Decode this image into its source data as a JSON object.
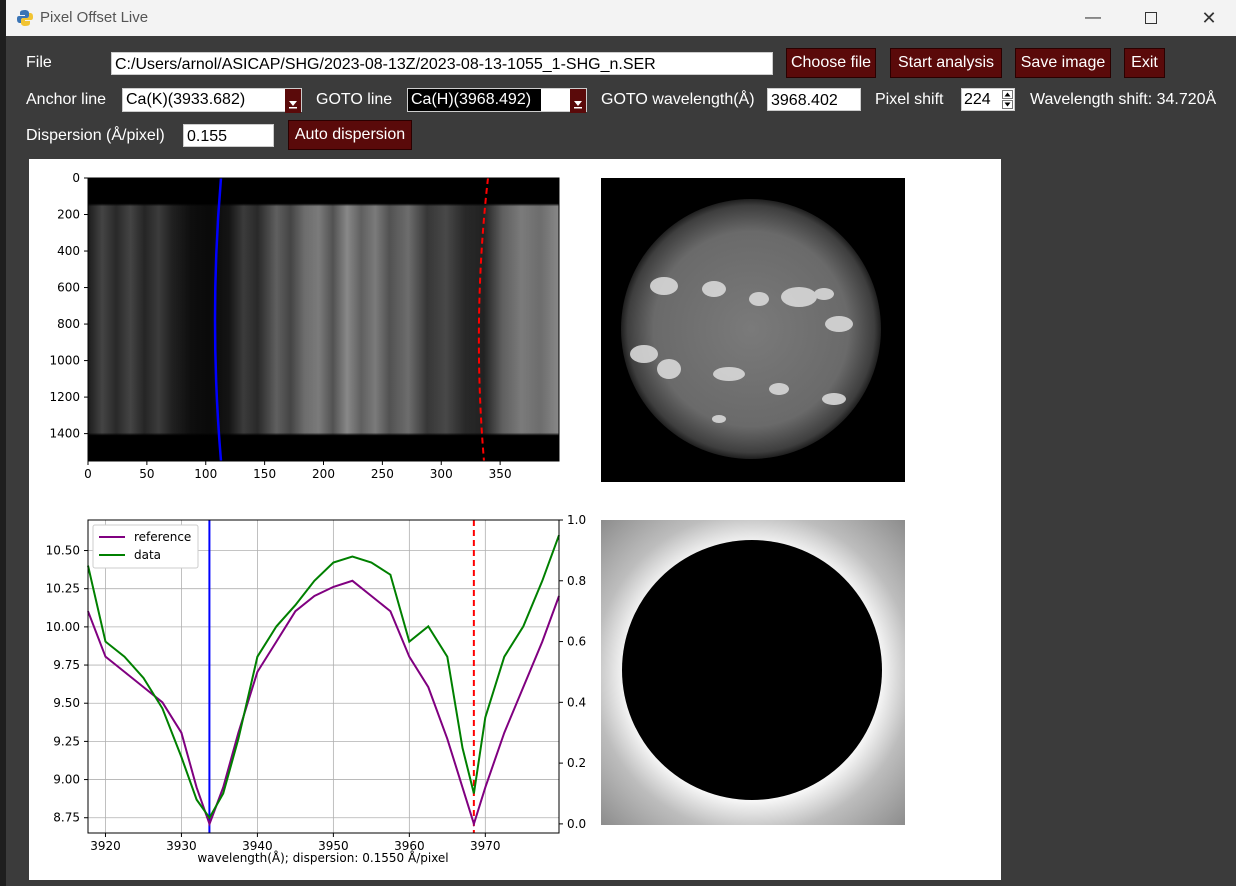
{
  "window": {
    "title": "Pixel Offset Live",
    "icon": "python-icon"
  },
  "controls": {
    "file_label": "File",
    "file_path": "C:/Users/arnol/ASICAP/SHG/2023-08-13Z/2023-08-13-1055_1-SHG_n.SER",
    "choose_file": "Choose file",
    "start_analysis": "Start analysis",
    "save_image": "Save image",
    "exit": "Exit",
    "anchor_line_label": "Anchor line",
    "anchor_line_value": "Ca(K)(3933.682)",
    "goto_line_label": "GOTO line",
    "goto_line_value": "Ca(H)(3968.492)",
    "goto_wavelength_label": "GOTO wavelength(Å)",
    "goto_wavelength_value": "3968.402",
    "pixel_shift_label": "Pixel shift",
    "pixel_shift_value": "224",
    "wavelength_shift": "Wavelength shift: 34.720Å",
    "dispersion_label": "Dispersion (Å/pixel)",
    "dispersion_value": "0.155",
    "auto_dispersion": "Auto dispersion"
  },
  "colors": {
    "button_bg": "#5a0a0a",
    "reference": "#800080",
    "data": "#008000",
    "anchor_line": "#0000ff",
    "goto_line": "#ff0000"
  },
  "spectrum_image": {
    "x_ticks": [
      "0",
      "50",
      "100",
      "150",
      "200",
      "250",
      "300",
      "350"
    ],
    "y_ticks": [
      "0",
      "200",
      "400",
      "600",
      "800",
      "1000",
      "1200",
      "1400"
    ],
    "x_range": [
      0,
      400
    ],
    "y_range": [
      0,
      1550
    ]
  },
  "chart_data": {
    "type": "line",
    "xlabel": "wavelength(Å); dispersion: 0.1550 Å/pixel",
    "xlim": [
      3917.7,
      3979.7
    ],
    "ylim_left": [
      8.65,
      10.7
    ],
    "ylim_right": [
      -0.03,
      1.0
    ],
    "x_ticks": [
      "3920",
      "3930",
      "3940",
      "3950",
      "3960",
      "3970"
    ],
    "y_ticks_left": [
      "8.75",
      "9.00",
      "9.25",
      "9.50",
      "9.75",
      "10.00",
      "10.25",
      "10.50"
    ],
    "y_ticks_right": [
      "0.0",
      "0.2",
      "0.4",
      "0.6",
      "0.8",
      "1.0"
    ],
    "legend": "top-left",
    "grid": true,
    "vlines": [
      {
        "x": 3933.682,
        "style": "solid",
        "color": "#0000ff"
      },
      {
        "x": 3968.492,
        "style": "dashed",
        "color": "#ff0000"
      }
    ],
    "series": [
      {
        "name": "reference",
        "color": "#800080",
        "x": [
          3917.7,
          3920,
          3922.5,
          3925,
          3927.5,
          3930,
          3932,
          3933.7,
          3935.5,
          3937.5,
          3940,
          3942.5,
          3945,
          3947.5,
          3950,
          3952.5,
          3955,
          3957.5,
          3960,
          3962.5,
          3965,
          3967,
          3968.5,
          3970,
          3972.5,
          3975,
          3977.5,
          3979.7
        ],
        "y": [
          0.7,
          0.55,
          0.5,
          0.45,
          0.4,
          0.3,
          0.12,
          0.0,
          0.12,
          0.3,
          0.5,
          0.6,
          0.7,
          0.75,
          0.78,
          0.8,
          0.75,
          0.7,
          0.55,
          0.45,
          0.28,
          0.12,
          0.0,
          0.12,
          0.3,
          0.45,
          0.6,
          0.75
        ]
      },
      {
        "name": "data",
        "color": "#008000",
        "x": [
          3917.7,
          3920,
          3922.5,
          3925,
          3927.5,
          3930,
          3932,
          3933.7,
          3935.5,
          3937.5,
          3940,
          3942.5,
          3945,
          3947.5,
          3950,
          3952.5,
          3955,
          3957.5,
          3960,
          3962.5,
          3965,
          3967,
          3968.5,
          3970,
          3972.5,
          3975,
          3977.5,
          3979.7
        ],
        "y": [
          0.85,
          0.6,
          0.55,
          0.48,
          0.38,
          0.22,
          0.08,
          0.02,
          0.1,
          0.28,
          0.55,
          0.65,
          0.72,
          0.8,
          0.86,
          0.88,
          0.86,
          0.82,
          0.6,
          0.65,
          0.55,
          0.25,
          0.1,
          0.35,
          0.55,
          0.65,
          0.8,
          0.95
        ]
      }
    ]
  }
}
